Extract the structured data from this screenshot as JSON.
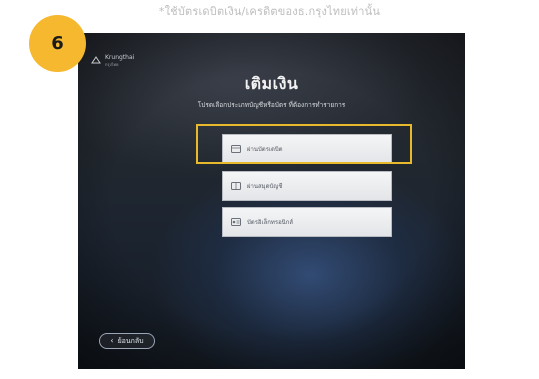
{
  "caption": "*ใช้บัตรเดบิตเงิน/เครดิตของธ.กรุงไทยเท่านั้น",
  "step_number": "6",
  "screen": {
    "logo": {
      "name": "Krungthai",
      "sub": "กรุงไทย"
    },
    "title": "เติมเงิน",
    "subtitle": "โปรดเลือกประเภทบัญชีหรือบัตร ที่ต้องการทำรายการ",
    "menu": [
      {
        "label": "ผ่านบัตรเดบิต",
        "icon": "card-icon"
      },
      {
        "label": "ผ่านสมุดบัญชี",
        "icon": "passbook-icon"
      },
      {
        "label": "บัตรอิเล็กทรอนิกส์",
        "icon": "id-card-icon"
      }
    ],
    "back_label": "ย้อนกลับ"
  },
  "colors": {
    "badge": "#f5b82e",
    "highlight": "#e8b92a"
  }
}
